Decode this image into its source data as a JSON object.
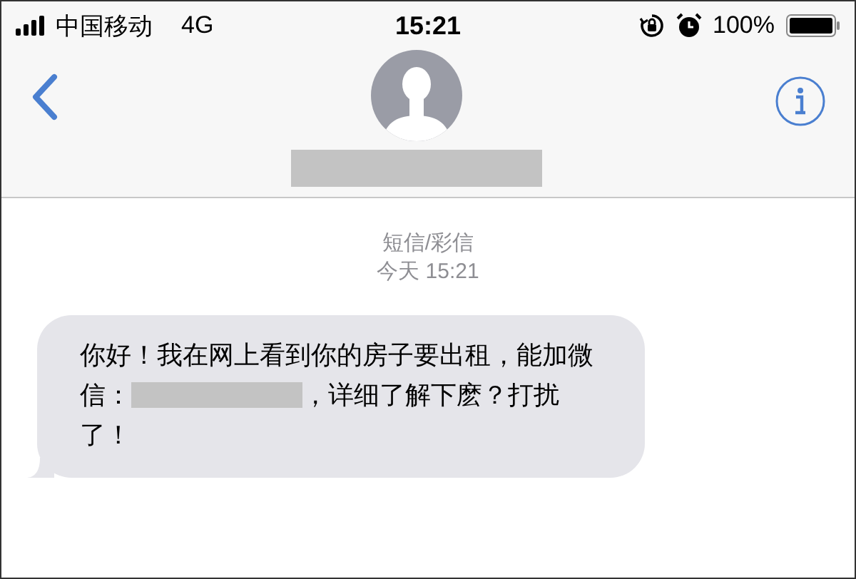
{
  "status_bar": {
    "carrier": "中国移动",
    "network": "4G",
    "time": "15:21",
    "battery": "100%"
  },
  "nav": {
    "contact": {
      "kind": "redacted"
    }
  },
  "thread": {
    "service": "短信/彩信",
    "timestamp": "今天 15:21",
    "messages": [
      {
        "parts": [
          {
            "kind": "text",
            "text": "你好！我在网上看到你的房子要出租，能加微信："
          },
          {
            "kind": "redacted"
          },
          {
            "kind": "text",
            "text": "，详细了解下麽？打扰了！"
          }
        ]
      }
    ]
  }
}
